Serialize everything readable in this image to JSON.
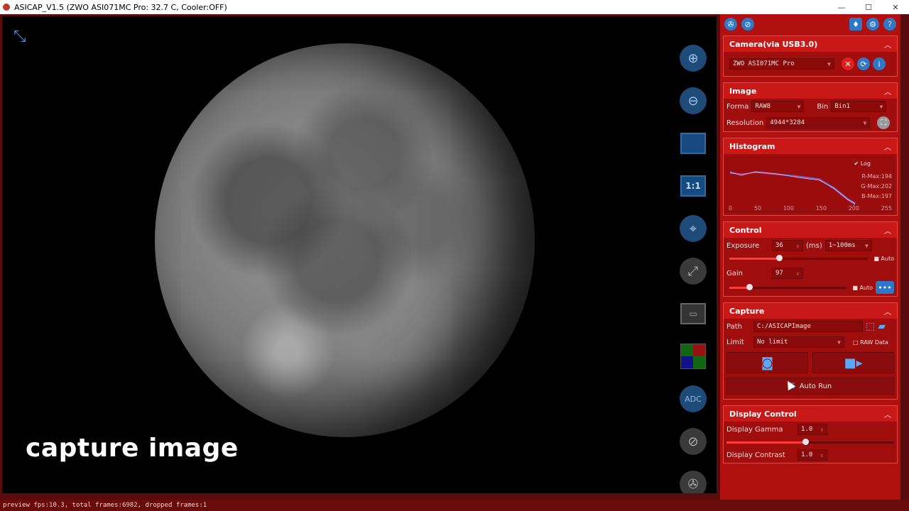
{
  "window": {
    "title": "ASICAP_V1.5 (ZWO ASI071MC Pro: 32.7 C, Cooler:OFF)",
    "min": "—",
    "max": "☐",
    "close": "✕"
  },
  "viewer": {
    "caption": "capture image"
  },
  "toolbar": [
    {
      "name": "zoom-in-icon",
      "glyph": "⊕"
    },
    {
      "name": "zoom-out-icon",
      "glyph": "⊖"
    },
    {
      "name": "fit-screen-icon",
      "glyph": ""
    },
    {
      "name": "one-to-one-icon",
      "glyph": "1:1"
    },
    {
      "name": "crosshair-icon",
      "glyph": "⌖"
    },
    {
      "name": "fullscreen-icon",
      "glyph": "⤢"
    },
    {
      "name": "roi-icon",
      "glyph": "▭"
    },
    {
      "name": "debayer-icon",
      "glyph": ""
    },
    {
      "name": "adc-icon",
      "glyph": "ADC"
    },
    {
      "name": "telescope-icon",
      "glyph": "⊘"
    },
    {
      "name": "filter-wheel-icon",
      "glyph": "✇"
    }
  ],
  "camera": {
    "header": "Camera(via USB3.0)",
    "model": "ZWO ASI071MC Pro"
  },
  "image": {
    "header": "Image",
    "format_label": "Forma",
    "format_value": "RAW8",
    "bin_label": "Bin",
    "bin_value": "Bin1",
    "resolution_label": "Resolution",
    "resolution_value": "4944*3284"
  },
  "histogram": {
    "header": "Histogram",
    "log_label": "Log",
    "rmax": "R-Max:194",
    "gmax": "G-Max:202",
    "bmax": "B-Max:197",
    "ticks": [
      "0",
      "50",
      "100",
      "150",
      "200",
      "255"
    ]
  },
  "control": {
    "header": "Control",
    "exposure_label": "Exposure",
    "exposure_value": "36",
    "exposure_unit": "(ms)",
    "exposure_range": "1~100ms",
    "exposure_auto": "Auto",
    "exposure_slider": 0.36,
    "gain_label": "Gain",
    "gain_value": "97",
    "gain_auto": "Auto",
    "gain_slider": 0.17
  },
  "capture": {
    "header": "Capture",
    "path_label": "Path",
    "path_value": "C:/ASICAPImage",
    "limit_label": "Limit",
    "limit_value": "No limit",
    "raw_label": "RAW Data",
    "autorun_label": "Auto Run"
  },
  "display": {
    "header": "Display Control",
    "gamma_label": "Display Gamma",
    "gamma_value": "1.0",
    "gamma_slider": 0.47,
    "contrast_label": "Display Contrast",
    "contrast_value": "1.0"
  },
  "status": "preview fps:10.3, total frames:6982, dropped frames:1"
}
